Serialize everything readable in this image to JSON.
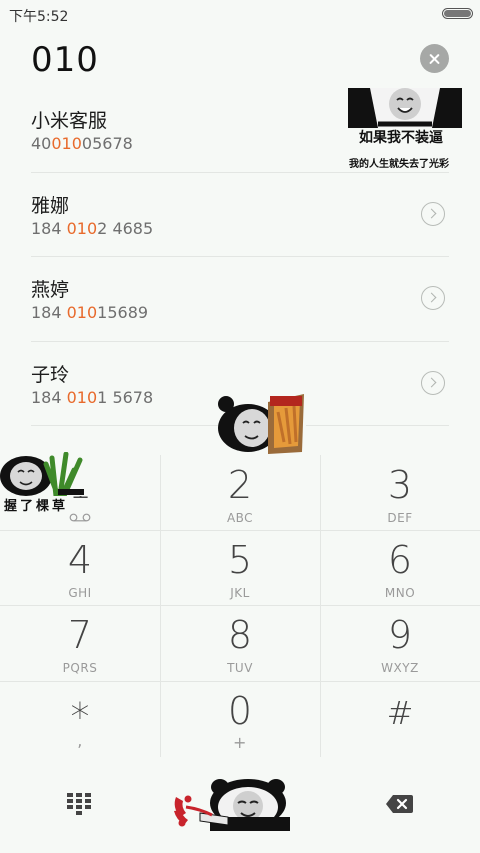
{
  "status_bar": {
    "time": "下午5:52"
  },
  "dialer": {
    "number": "010"
  },
  "contacts": [
    {
      "name": "小米客服",
      "number_before": "40",
      "number_match": "010",
      "number_after": "05678"
    },
    {
      "name": "雅娜",
      "number_before": "184 ",
      "number_match": "010",
      "number_after": "2 4685"
    },
    {
      "name": "燕婷",
      "number_before": "184 ",
      "number_match": "010",
      "number_after": "15689"
    },
    {
      "name": "子玲",
      "number_before": "184 ",
      "number_match": "010",
      "number_after": "1 5678"
    }
  ],
  "keypad": {
    "k1": {
      "digit": "1"
    },
    "k2": {
      "digit": "2",
      "letters": "ABC"
    },
    "k3": {
      "digit": "3",
      "letters": "DEF"
    },
    "k4": {
      "digit": "4",
      "letters": "GHI"
    },
    "k5": {
      "digit": "5",
      "letters": "JKL"
    },
    "k6": {
      "digit": "6",
      "letters": "MNO"
    },
    "k7": {
      "digit": "7",
      "letters": "PQRS"
    },
    "k8": {
      "digit": "8",
      "letters": "TUV"
    },
    "k9": {
      "digit": "9",
      "letters": "WXYZ"
    },
    "kstar": {
      "digit": "*",
      "letters": ","
    },
    "k0": {
      "digit": "0",
      "letters": "+"
    },
    "khash": {
      "digit": "#"
    }
  },
  "stickers": {
    "top_right": {
      "line1": "如果我不装逼",
      "line2": "我的人生就失去了光彩"
    },
    "left": {
      "caption": "握了棵草"
    }
  },
  "colors": {
    "highlight": "#e86a2c",
    "background": "#f6f9f6",
    "call_phone": "#c8242c"
  },
  "icons": {
    "clear": "clear-icon",
    "detail": "chevron-right-circle-icon",
    "voicemail": "voicemail-icon",
    "dialpad": "dialpad-icon",
    "backspace": "backspace-icon"
  }
}
